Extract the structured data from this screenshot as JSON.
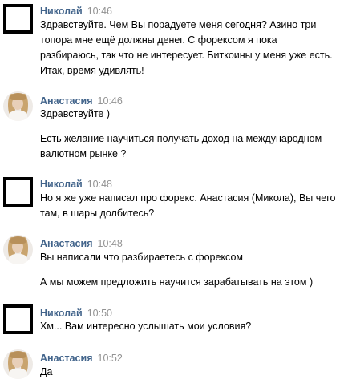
{
  "messages": [
    {
      "author": "Николай",
      "time": "10:46",
      "avatar": "black-square-avatar",
      "lines": [
        "Здравствуйте. Чем Вы порадуете меня сегодня? Азино три",
        "топора мне ещё должны денег. С форексом я пока",
        "разбираюсь, так что не интересует. Биткоины у меня уже есть.",
        "Итак, время удивлять!"
      ]
    },
    {
      "author": "Анастасия",
      "time": "10:46",
      "avatar": "woman-photo-avatar",
      "lines": [
        "Здравствуйте )"
      ],
      "followup": [
        "Есть желание научиться получать доход на международном",
        "валютном рынке ?"
      ]
    },
    {
      "author": "Николай",
      "time": "10:48",
      "avatar": "black-square-avatar",
      "lines": [
        "Но я же уже написал про форекс. Анастасия (Микола), Вы чего",
        "там, в шары долбитесь?"
      ]
    },
    {
      "author": "Анастасия",
      "time": "10:48",
      "avatar": "woman-photo-avatar",
      "lines": [
        "Вы написали что разбираетесь с форексом"
      ],
      "followup": [
        "А мы можем предложить научится зарабатывать на этом )"
      ]
    },
    {
      "author": "Николай",
      "time": "10:50",
      "avatar": "black-square-avatar",
      "lines": [
        "Хм... Вам интересно услышать мои условия?"
      ]
    },
    {
      "author": "Анастасия",
      "time": "10:52",
      "avatar": "woman-photo-avatar",
      "lines": [
        "Да"
      ]
    }
  ],
  "colors": {
    "author": "#42648b",
    "time": "#939393",
    "text": "#000000",
    "background": "#ffffff"
  }
}
